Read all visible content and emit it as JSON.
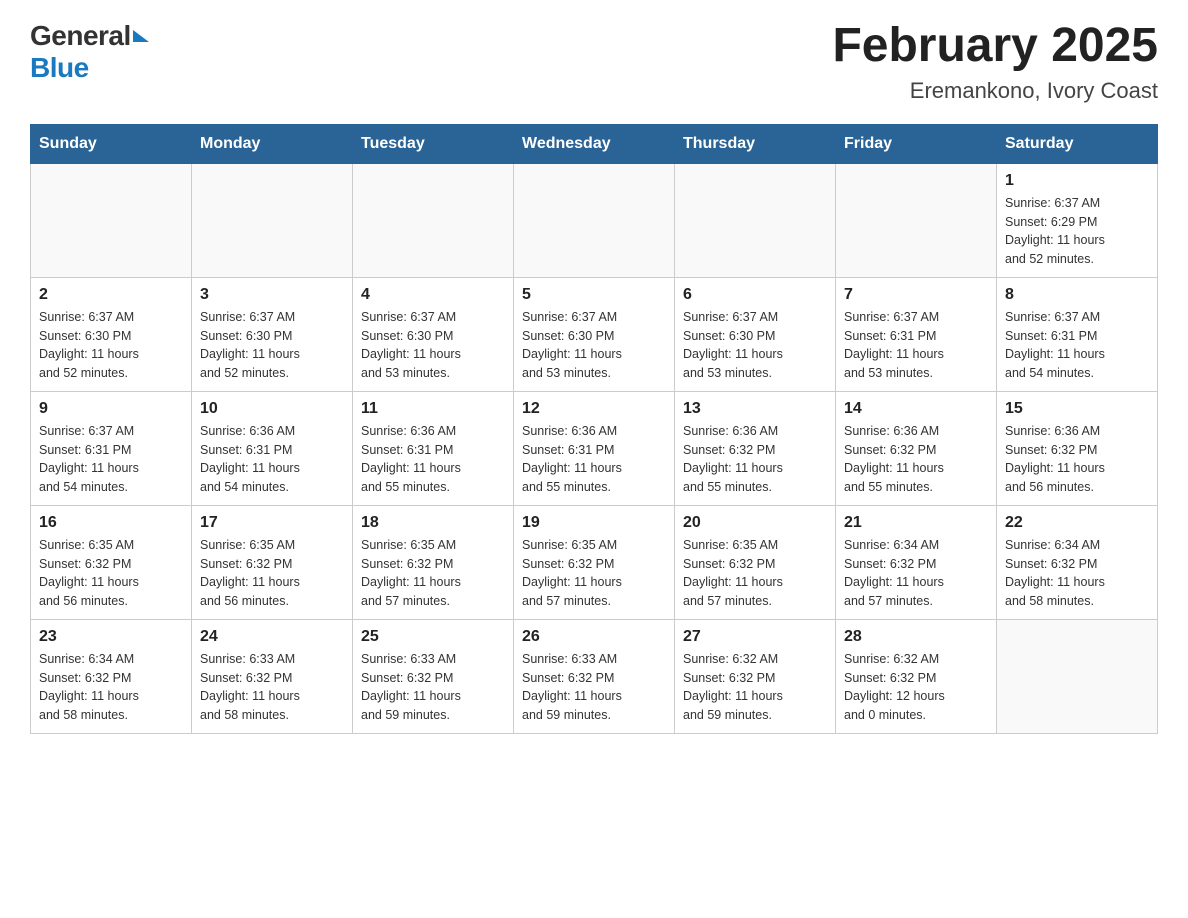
{
  "header": {
    "logo_general": "General",
    "logo_blue": "Blue",
    "title": "February 2025",
    "subtitle": "Eremankono, Ivory Coast"
  },
  "days_of_week": [
    "Sunday",
    "Monday",
    "Tuesday",
    "Wednesday",
    "Thursday",
    "Friday",
    "Saturday"
  ],
  "weeks": [
    [
      {
        "day": "",
        "info": ""
      },
      {
        "day": "",
        "info": ""
      },
      {
        "day": "",
        "info": ""
      },
      {
        "day": "",
        "info": ""
      },
      {
        "day": "",
        "info": ""
      },
      {
        "day": "",
        "info": ""
      },
      {
        "day": "1",
        "info": "Sunrise: 6:37 AM\nSunset: 6:29 PM\nDaylight: 11 hours\nand 52 minutes."
      }
    ],
    [
      {
        "day": "2",
        "info": "Sunrise: 6:37 AM\nSunset: 6:30 PM\nDaylight: 11 hours\nand 52 minutes."
      },
      {
        "day": "3",
        "info": "Sunrise: 6:37 AM\nSunset: 6:30 PM\nDaylight: 11 hours\nand 52 minutes."
      },
      {
        "day": "4",
        "info": "Sunrise: 6:37 AM\nSunset: 6:30 PM\nDaylight: 11 hours\nand 53 minutes."
      },
      {
        "day": "5",
        "info": "Sunrise: 6:37 AM\nSunset: 6:30 PM\nDaylight: 11 hours\nand 53 minutes."
      },
      {
        "day": "6",
        "info": "Sunrise: 6:37 AM\nSunset: 6:30 PM\nDaylight: 11 hours\nand 53 minutes."
      },
      {
        "day": "7",
        "info": "Sunrise: 6:37 AM\nSunset: 6:31 PM\nDaylight: 11 hours\nand 53 minutes."
      },
      {
        "day": "8",
        "info": "Sunrise: 6:37 AM\nSunset: 6:31 PM\nDaylight: 11 hours\nand 54 minutes."
      }
    ],
    [
      {
        "day": "9",
        "info": "Sunrise: 6:37 AM\nSunset: 6:31 PM\nDaylight: 11 hours\nand 54 minutes."
      },
      {
        "day": "10",
        "info": "Sunrise: 6:36 AM\nSunset: 6:31 PM\nDaylight: 11 hours\nand 54 minutes."
      },
      {
        "day": "11",
        "info": "Sunrise: 6:36 AM\nSunset: 6:31 PM\nDaylight: 11 hours\nand 55 minutes."
      },
      {
        "day": "12",
        "info": "Sunrise: 6:36 AM\nSunset: 6:31 PM\nDaylight: 11 hours\nand 55 minutes."
      },
      {
        "day": "13",
        "info": "Sunrise: 6:36 AM\nSunset: 6:32 PM\nDaylight: 11 hours\nand 55 minutes."
      },
      {
        "day": "14",
        "info": "Sunrise: 6:36 AM\nSunset: 6:32 PM\nDaylight: 11 hours\nand 55 minutes."
      },
      {
        "day": "15",
        "info": "Sunrise: 6:36 AM\nSunset: 6:32 PM\nDaylight: 11 hours\nand 56 minutes."
      }
    ],
    [
      {
        "day": "16",
        "info": "Sunrise: 6:35 AM\nSunset: 6:32 PM\nDaylight: 11 hours\nand 56 minutes."
      },
      {
        "day": "17",
        "info": "Sunrise: 6:35 AM\nSunset: 6:32 PM\nDaylight: 11 hours\nand 56 minutes."
      },
      {
        "day": "18",
        "info": "Sunrise: 6:35 AM\nSunset: 6:32 PM\nDaylight: 11 hours\nand 57 minutes."
      },
      {
        "day": "19",
        "info": "Sunrise: 6:35 AM\nSunset: 6:32 PM\nDaylight: 11 hours\nand 57 minutes."
      },
      {
        "day": "20",
        "info": "Sunrise: 6:35 AM\nSunset: 6:32 PM\nDaylight: 11 hours\nand 57 minutes."
      },
      {
        "day": "21",
        "info": "Sunrise: 6:34 AM\nSunset: 6:32 PM\nDaylight: 11 hours\nand 57 minutes."
      },
      {
        "day": "22",
        "info": "Sunrise: 6:34 AM\nSunset: 6:32 PM\nDaylight: 11 hours\nand 58 minutes."
      }
    ],
    [
      {
        "day": "23",
        "info": "Sunrise: 6:34 AM\nSunset: 6:32 PM\nDaylight: 11 hours\nand 58 minutes."
      },
      {
        "day": "24",
        "info": "Sunrise: 6:33 AM\nSunset: 6:32 PM\nDaylight: 11 hours\nand 58 minutes."
      },
      {
        "day": "25",
        "info": "Sunrise: 6:33 AM\nSunset: 6:32 PM\nDaylight: 11 hours\nand 59 minutes."
      },
      {
        "day": "26",
        "info": "Sunrise: 6:33 AM\nSunset: 6:32 PM\nDaylight: 11 hours\nand 59 minutes."
      },
      {
        "day": "27",
        "info": "Sunrise: 6:32 AM\nSunset: 6:32 PM\nDaylight: 11 hours\nand 59 minutes."
      },
      {
        "day": "28",
        "info": "Sunrise: 6:32 AM\nSunset: 6:32 PM\nDaylight: 12 hours\nand 0 minutes."
      },
      {
        "day": "",
        "info": ""
      }
    ]
  ]
}
